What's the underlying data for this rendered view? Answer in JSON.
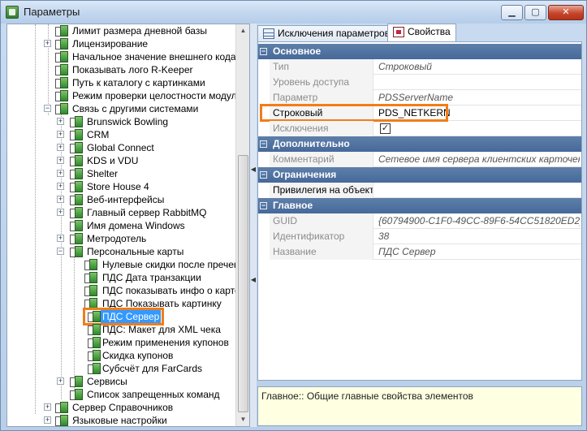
{
  "window": {
    "title": "Параметры",
    "min_glyph": "▁",
    "max_glyph": "▢",
    "close_glyph": "✕"
  },
  "tree": {
    "items": [
      {
        "label": "Лимит размера дневной базы"
      },
      {
        "label": "Лицензирование"
      },
      {
        "label": "Начальное значение внешнего кода"
      },
      {
        "label": "Показывать лого R-Keeper"
      },
      {
        "label": "Путь к каталогу с картинками"
      },
      {
        "label": "Режим проверки целостности модулей"
      },
      {
        "label": "Связь с другими системами"
      },
      {
        "label": "Brunswick Bowling"
      },
      {
        "label": "CRM"
      },
      {
        "label": "Global Connect"
      },
      {
        "label": "KDS и VDU"
      },
      {
        "label": "Shelter"
      },
      {
        "label": "Store House 4"
      },
      {
        "label": "Веб-интерфейсы"
      },
      {
        "label": "Главный сервер RabbitMQ"
      },
      {
        "label": "Имя домена Windows"
      },
      {
        "label": "Метродотель"
      },
      {
        "label": "Персональные карты"
      },
      {
        "label": "Нулевые скидки после пречека"
      },
      {
        "label": "ПДС Дата транзакции"
      },
      {
        "label": "ПДС показывать инфо о карте"
      },
      {
        "label": "ПДС Показывать картинку"
      },
      {
        "label": "ПДС Сервер"
      },
      {
        "label": "ПДС: Макет для XML чека"
      },
      {
        "label": "Режим применения купонов"
      },
      {
        "label": "Скидка купонов"
      },
      {
        "label": "Субсчёт для FarCards"
      },
      {
        "label": "Сервисы"
      },
      {
        "label": "Список запрещенных команд"
      },
      {
        "label": "Сервер Справочников"
      },
      {
        "label": "Языковые настройки"
      }
    ],
    "plus": "+",
    "minus": "−"
  },
  "tabs": [
    {
      "label": "Исключения параметров",
      "icon": "grid-icon"
    },
    {
      "label": "Свойства",
      "icon": "properties-icon"
    }
  ],
  "property_grid": {
    "categories": [
      {
        "label": "Основное",
        "rows": [
          {
            "name": "Тип",
            "value": "Строковый"
          },
          {
            "name": "Уровень доступа",
            "value": ""
          },
          {
            "name": "Параметр",
            "value": "PDSServerName"
          },
          {
            "name": "Строковый",
            "value": "PDS_NETKERN"
          },
          {
            "name": "Исключения",
            "value": "✓"
          }
        ]
      },
      {
        "label": "Дополнительно",
        "rows": [
          {
            "name": "Комментарий",
            "value": "Сетевое имя сервера клиентских карточек"
          }
        ]
      },
      {
        "label": "Ограничения",
        "rows": [
          {
            "name": "Привилегия на объект",
            "value": ""
          }
        ]
      },
      {
        "label": "Главное",
        "rows": [
          {
            "name": "GUID",
            "value": "{60794900-C1F0-49CC-89F6-54CC51820ED2}"
          },
          {
            "name": "Идентификатор",
            "value": "38"
          },
          {
            "name": "Название",
            "value": "ПДС Сервер"
          }
        ]
      }
    ],
    "collapse_glyph": "−"
  },
  "description": "Главное:: Общие главные свойства элементов",
  "colors": {
    "highlight": "#f07d1a",
    "category_header": "#47699a",
    "selection": "#3399ff"
  }
}
